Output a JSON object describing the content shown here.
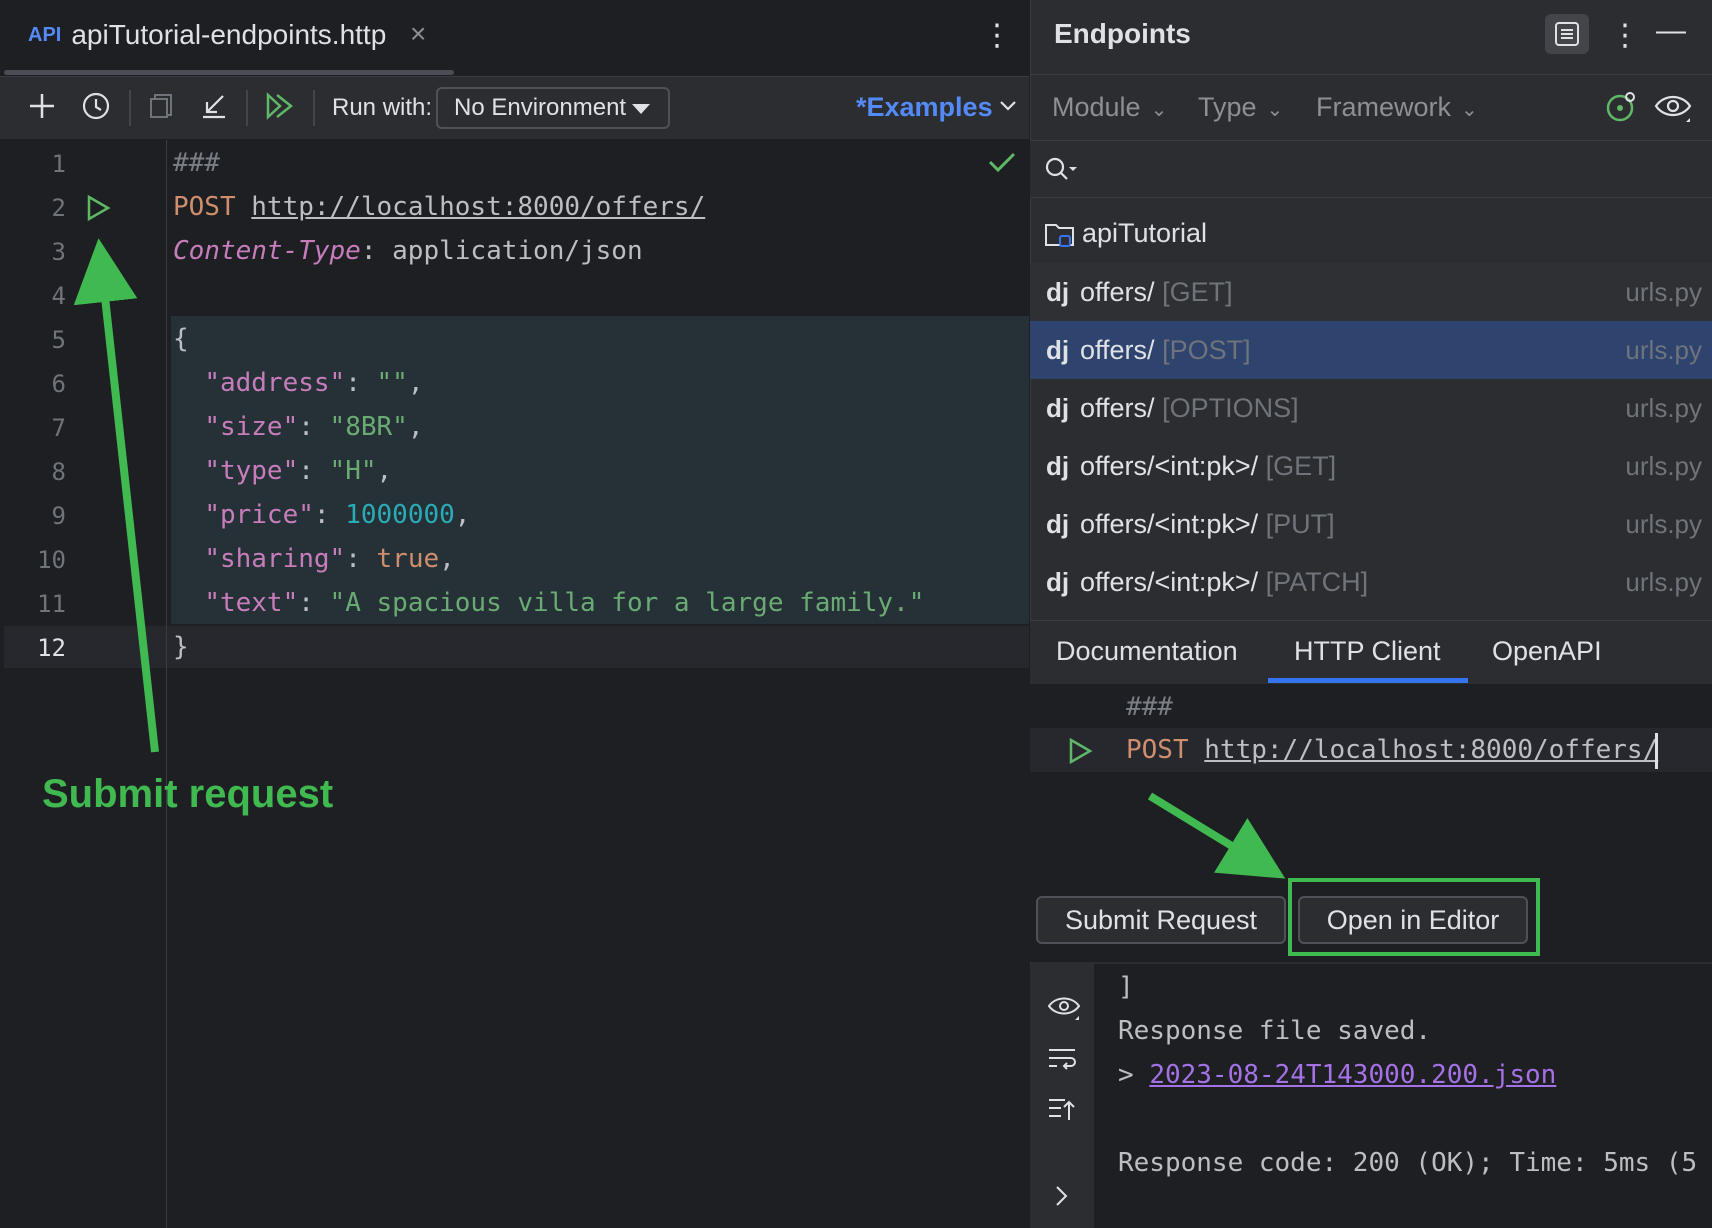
{
  "editor": {
    "tab_icon": "API",
    "tab_title": "apiTutorial-endpoints.http",
    "tab_close": "×",
    "more": "⋮",
    "toolbar": {
      "run_with_label": "Run with:",
      "environment": "No Environment",
      "examples_label": "*Examples"
    },
    "line_numbers": [
      "1",
      "2",
      "3",
      "4",
      "5",
      "6",
      "7",
      "8",
      "9",
      "10",
      "11",
      "12"
    ],
    "code": {
      "l1": "###",
      "l2_method": "POST",
      "l2_url": "http://localhost:8000/offers/",
      "l3_header": "Content-Type",
      "l3_colon": ": ",
      "l3_value": "application/json",
      "l5": "{",
      "l6_key": "\"address\"",
      "l6_val": "\"\"",
      "l7_key": "\"size\"",
      "l7_val": "\"8BR\"",
      "l8_key": "\"type\"",
      "l8_val": "\"H\"",
      "l9_key": "\"price\"",
      "l9_val": "1000000",
      "l10_key": "\"sharing\"",
      "l10_val": "true",
      "l11_key": "\"text\"",
      "l11_val": "\"A spacious villa for a large family.\"",
      "l12": "}"
    },
    "annotation": "Submit request"
  },
  "endpoints": {
    "title": "Endpoints",
    "more": "⋮",
    "minimize": "—",
    "filters": [
      "Module",
      "Type",
      "Framework"
    ],
    "root": "apiTutorial",
    "items": [
      {
        "badge": "dj",
        "path": "offers/",
        "verb": "[GET]",
        "file": "urls.py"
      },
      {
        "badge": "dj",
        "path": "offers/",
        "verb": "[POST]",
        "file": "urls.py"
      },
      {
        "badge": "dj",
        "path": "offers/",
        "verb": "[OPTIONS]",
        "file": "urls.py"
      },
      {
        "badge": "dj",
        "path": "offers/<int:pk>/",
        "verb": "[GET]",
        "file": "urls.py"
      },
      {
        "badge": "dj",
        "path": "offers/<int:pk>/",
        "verb": "[PUT]",
        "file": "urls.py"
      },
      {
        "badge": "dj",
        "path": "offers/<int:pk>/",
        "verb": "[PATCH]",
        "file": "urls.py"
      }
    ],
    "tabs": [
      "Documentation",
      "HTTP Client",
      "OpenAPI"
    ],
    "http_client": {
      "comment": "###",
      "method": "POST",
      "url": "http://localhost:8000/offers/"
    },
    "buttons": {
      "submit": "Submit Request",
      "open": "Open in Editor"
    },
    "response": {
      "bracket": "]",
      "saved": "Response file saved.",
      "prefix": "> ",
      "file_link": "2023-08-24T143000.200.json",
      "code_line": "Response code: 200 (OK); Time: 5ms (5"
    }
  },
  "colors": {
    "annotation_green": "#3fb950",
    "accent_blue": "#548af7",
    "selection": "#2e436e"
  }
}
